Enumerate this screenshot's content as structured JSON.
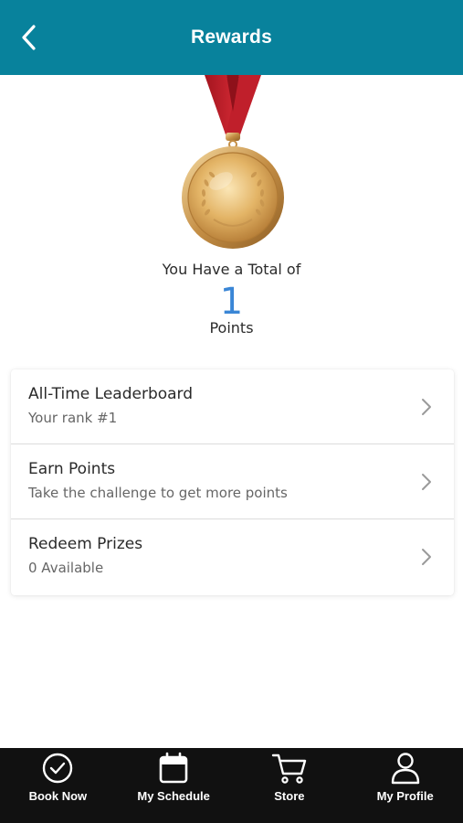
{
  "header": {
    "title": "Rewards",
    "back_icon": "chevron-left-icon"
  },
  "summary": {
    "intro": "You Have a Total of",
    "points": "1",
    "unit": "Points"
  },
  "menu": {
    "items": [
      {
        "title": "All-Time Leaderboard",
        "subtitle": "Your rank #1"
      },
      {
        "title": "Earn Points",
        "subtitle": "Take the challenge to get more points"
      },
      {
        "title": "Redeem Prizes",
        "subtitle": "0 Available"
      }
    ]
  },
  "tabbar": {
    "tabs": [
      {
        "label": "Book Now",
        "icon": "check-circle-icon"
      },
      {
        "label": "My Schedule",
        "icon": "calendar-icon"
      },
      {
        "label": "Store",
        "icon": "cart-icon"
      },
      {
        "label": "My Profile",
        "icon": "user-icon"
      }
    ]
  },
  "colors": {
    "header_bg": "#08829c",
    "points_accent": "#3a86d6",
    "tabbar_bg": "#111111",
    "ribbon": "#c4202c",
    "medal_gold": "#d7a552"
  }
}
